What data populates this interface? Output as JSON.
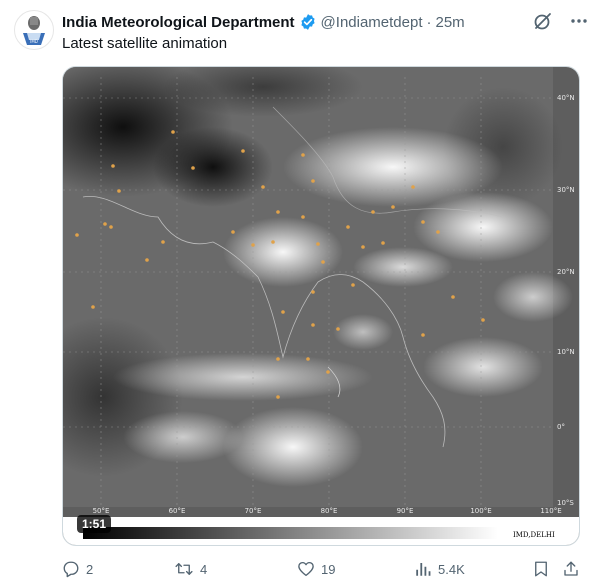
{
  "post": {
    "author_name": "India Meteorological Department",
    "handle": "@Indiametdept",
    "separator": "·",
    "time": "25m",
    "text": "Latest satellite animation"
  },
  "media": {
    "duration": "1:51",
    "lat_labels": [
      "40°N",
      "30°N",
      "20°N",
      "10°N",
      "0°",
      "10°S"
    ],
    "lon_labels": [
      "50°E",
      "60°E",
      "70°E",
      "80°E",
      "90°E",
      "100°E",
      "110°E"
    ],
    "credit": "IMD,DELHI"
  },
  "actions": {
    "replies": "2",
    "reposts": "4",
    "likes": "19",
    "views": "5.4K"
  },
  "colors": {
    "text_primary": "#0f1419",
    "text_secondary": "#536471",
    "verified": "#1d9bf0",
    "map_label": "#e0a24a"
  },
  "icons": [
    "emblem-avatar",
    "verified-badge-icon",
    "grok-icon",
    "more-icon",
    "reply-icon",
    "repost-icon",
    "like-icon",
    "views-icon",
    "bookmark-icon",
    "share-icon"
  ]
}
